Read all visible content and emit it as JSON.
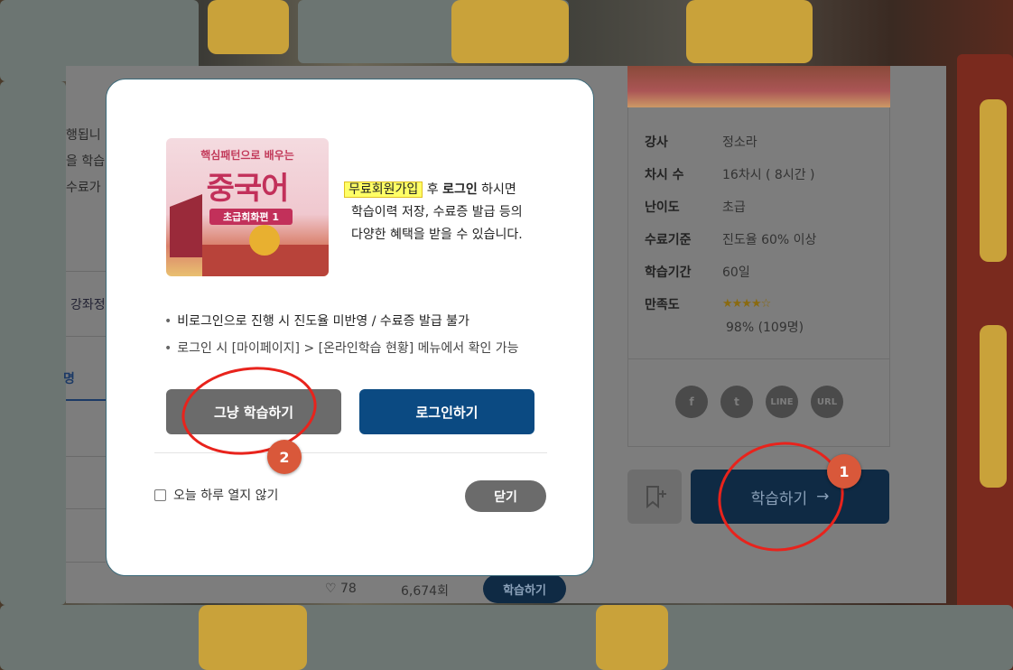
{
  "page_left": {
    "lines": [
      "행됩니",
      "을 학습",
      "수료가"
    ],
    "tab": "강좌정",
    "tab_active": "명"
  },
  "course_info": {
    "rows": [
      {
        "key": "강사",
        "value": "정소라"
      },
      {
        "key": "차시 수",
        "value": "16차시 ( 8시간 )"
      },
      {
        "key": "난이도",
        "value": "초급"
      },
      {
        "key": "수료기준",
        "value": "진도율 60% 이상"
      },
      {
        "key": "학습기간",
        "value": "60일"
      },
      {
        "key": "만족도",
        "value": ""
      }
    ],
    "stars": 4.5,
    "rating_text": "98% (109명)",
    "share": [
      {
        "icon": "facebook-icon",
        "label": "f"
      },
      {
        "icon": "twitter-icon",
        "label": "t"
      },
      {
        "icon": "line-icon",
        "label": "LINE"
      },
      {
        "icon": "url-icon",
        "label": "URL"
      }
    ]
  },
  "actions": {
    "learn_label": "학습하기",
    "learn_arrow": "→",
    "bookmark_icon": "bookmark-add-icon"
  },
  "bottom": {
    "likes": "78",
    "views": "6,674회",
    "learn_label": "학습하기"
  },
  "modal": {
    "course_image": {
      "title_small": "핵심패턴으로 배우는",
      "title_big": "중국어",
      "subtitle": "초급회화편 1"
    },
    "promo": {
      "highlight": "무료회원가입",
      "after_highlight": " 후 ",
      "bold": "로그인",
      "rest1": " 하시면",
      "line2": "학습이력 저장, 수료증 발급 등의",
      "line3": "다양한 혜택을 받을 수 있습니다."
    },
    "bullets": [
      "비로그인으로 진행 시 진도율 미반영 / 수료증 발급 불가",
      "로그인 시 [마이페이지] > [온라인학습 현황] 메뉴에서 확인 가능"
    ],
    "btn_plain": "그냥 학습하기",
    "btn_login": "로그인하기",
    "checkbox_label": "오늘 하루 열지 않기",
    "btn_close": "닫기"
  },
  "annotations": {
    "badge1": "1",
    "badge2": "2",
    "color": "#e8231c"
  }
}
